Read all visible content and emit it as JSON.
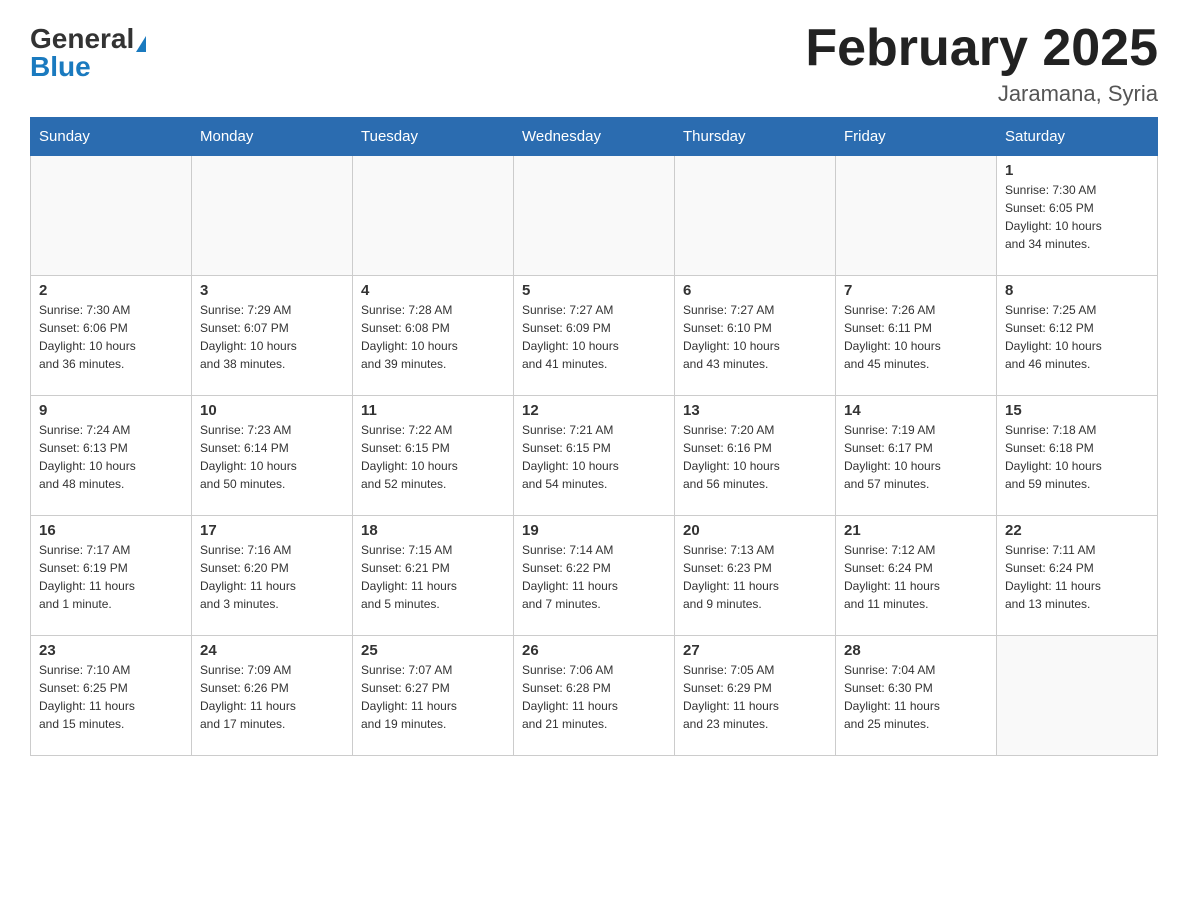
{
  "header": {
    "logo_general": "General",
    "logo_blue": "Blue",
    "month_title": "February 2025",
    "location": "Jaramana, Syria"
  },
  "days_of_week": [
    "Sunday",
    "Monday",
    "Tuesday",
    "Wednesday",
    "Thursday",
    "Friday",
    "Saturday"
  ],
  "weeks": [
    [
      {
        "day": "",
        "info": ""
      },
      {
        "day": "",
        "info": ""
      },
      {
        "day": "",
        "info": ""
      },
      {
        "day": "",
        "info": ""
      },
      {
        "day": "",
        "info": ""
      },
      {
        "day": "",
        "info": ""
      },
      {
        "day": "1",
        "info": "Sunrise: 7:30 AM\nSunset: 6:05 PM\nDaylight: 10 hours\nand 34 minutes."
      }
    ],
    [
      {
        "day": "2",
        "info": "Sunrise: 7:30 AM\nSunset: 6:06 PM\nDaylight: 10 hours\nand 36 minutes."
      },
      {
        "day": "3",
        "info": "Sunrise: 7:29 AM\nSunset: 6:07 PM\nDaylight: 10 hours\nand 38 minutes."
      },
      {
        "day": "4",
        "info": "Sunrise: 7:28 AM\nSunset: 6:08 PM\nDaylight: 10 hours\nand 39 minutes."
      },
      {
        "day": "5",
        "info": "Sunrise: 7:27 AM\nSunset: 6:09 PM\nDaylight: 10 hours\nand 41 minutes."
      },
      {
        "day": "6",
        "info": "Sunrise: 7:27 AM\nSunset: 6:10 PM\nDaylight: 10 hours\nand 43 minutes."
      },
      {
        "day": "7",
        "info": "Sunrise: 7:26 AM\nSunset: 6:11 PM\nDaylight: 10 hours\nand 45 minutes."
      },
      {
        "day": "8",
        "info": "Sunrise: 7:25 AM\nSunset: 6:12 PM\nDaylight: 10 hours\nand 46 minutes."
      }
    ],
    [
      {
        "day": "9",
        "info": "Sunrise: 7:24 AM\nSunset: 6:13 PM\nDaylight: 10 hours\nand 48 minutes."
      },
      {
        "day": "10",
        "info": "Sunrise: 7:23 AM\nSunset: 6:14 PM\nDaylight: 10 hours\nand 50 minutes."
      },
      {
        "day": "11",
        "info": "Sunrise: 7:22 AM\nSunset: 6:15 PM\nDaylight: 10 hours\nand 52 minutes."
      },
      {
        "day": "12",
        "info": "Sunrise: 7:21 AM\nSunset: 6:15 PM\nDaylight: 10 hours\nand 54 minutes."
      },
      {
        "day": "13",
        "info": "Sunrise: 7:20 AM\nSunset: 6:16 PM\nDaylight: 10 hours\nand 56 minutes."
      },
      {
        "day": "14",
        "info": "Sunrise: 7:19 AM\nSunset: 6:17 PM\nDaylight: 10 hours\nand 57 minutes."
      },
      {
        "day": "15",
        "info": "Sunrise: 7:18 AM\nSunset: 6:18 PM\nDaylight: 10 hours\nand 59 minutes."
      }
    ],
    [
      {
        "day": "16",
        "info": "Sunrise: 7:17 AM\nSunset: 6:19 PM\nDaylight: 11 hours\nand 1 minute."
      },
      {
        "day": "17",
        "info": "Sunrise: 7:16 AM\nSunset: 6:20 PM\nDaylight: 11 hours\nand 3 minutes."
      },
      {
        "day": "18",
        "info": "Sunrise: 7:15 AM\nSunset: 6:21 PM\nDaylight: 11 hours\nand 5 minutes."
      },
      {
        "day": "19",
        "info": "Sunrise: 7:14 AM\nSunset: 6:22 PM\nDaylight: 11 hours\nand 7 minutes."
      },
      {
        "day": "20",
        "info": "Sunrise: 7:13 AM\nSunset: 6:23 PM\nDaylight: 11 hours\nand 9 minutes."
      },
      {
        "day": "21",
        "info": "Sunrise: 7:12 AM\nSunset: 6:24 PM\nDaylight: 11 hours\nand 11 minutes."
      },
      {
        "day": "22",
        "info": "Sunrise: 7:11 AM\nSunset: 6:24 PM\nDaylight: 11 hours\nand 13 minutes."
      }
    ],
    [
      {
        "day": "23",
        "info": "Sunrise: 7:10 AM\nSunset: 6:25 PM\nDaylight: 11 hours\nand 15 minutes."
      },
      {
        "day": "24",
        "info": "Sunrise: 7:09 AM\nSunset: 6:26 PM\nDaylight: 11 hours\nand 17 minutes."
      },
      {
        "day": "25",
        "info": "Sunrise: 7:07 AM\nSunset: 6:27 PM\nDaylight: 11 hours\nand 19 minutes."
      },
      {
        "day": "26",
        "info": "Sunrise: 7:06 AM\nSunset: 6:28 PM\nDaylight: 11 hours\nand 21 minutes."
      },
      {
        "day": "27",
        "info": "Sunrise: 7:05 AM\nSunset: 6:29 PM\nDaylight: 11 hours\nand 23 minutes."
      },
      {
        "day": "28",
        "info": "Sunrise: 7:04 AM\nSunset: 6:30 PM\nDaylight: 11 hours\nand 25 minutes."
      },
      {
        "day": "",
        "info": ""
      }
    ]
  ]
}
